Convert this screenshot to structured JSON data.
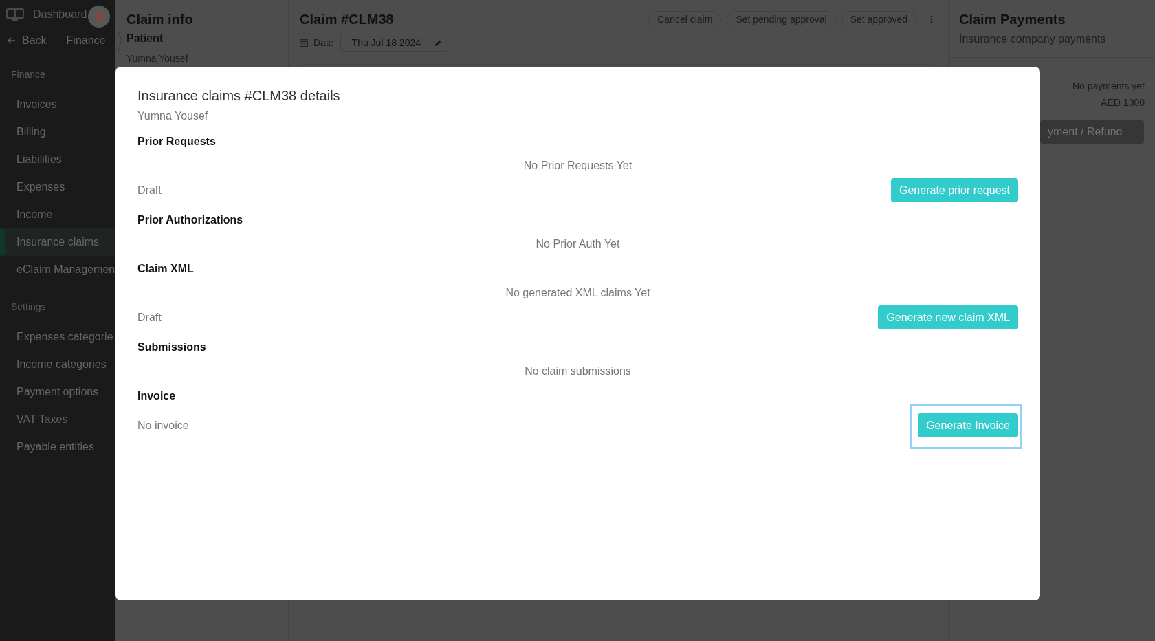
{
  "sidebar": {
    "brand": "Dashboard",
    "back": "Back",
    "breadcrumb": "Finance",
    "sections": [
      {
        "label": "Finance",
        "items": [
          {
            "label": "Invoices",
            "selected": false
          },
          {
            "label": "Billing",
            "selected": false
          },
          {
            "label": "Liabilities",
            "selected": false
          },
          {
            "label": "Expenses",
            "selected": false
          },
          {
            "label": "Income",
            "selected": false
          },
          {
            "label": "Insurance claims",
            "selected": true
          },
          {
            "label": "eClaim Managemen",
            "selected": false
          }
        ]
      },
      {
        "label": "Settings",
        "items": [
          {
            "label": "Expenses categorie",
            "selected": false
          },
          {
            "label": "Income categories",
            "selected": false
          },
          {
            "label": "Payment options",
            "selected": false
          },
          {
            "label": "VAT Taxes",
            "selected": false
          },
          {
            "label": "Payable entities",
            "selected": false
          }
        ]
      }
    ]
  },
  "claim_info": {
    "title": "Claim info",
    "patient_label": "Patient",
    "patient_name": "Yumna Yousef"
  },
  "claim": {
    "title": "Claim #CLM38",
    "actions": [
      "Cancel claim",
      "Set pending approval",
      "Set approved"
    ],
    "date_label": "Date",
    "date_value": "Thu Jul 18 2024"
  },
  "payments": {
    "title": "Claim Payments",
    "subtitle": "Insurance company payments",
    "status": "No payments yet",
    "amount": "AED 1300",
    "button": "yment / Refund"
  },
  "modal": {
    "title": "Insurance claims #CLM38 details",
    "patient": "Yumna Yousef",
    "sections": [
      {
        "heading": "Prior Requests",
        "empty_text": "No Prior Requests Yet",
        "rows": [
          {
            "status": "Draft",
            "action": "Generate prior request",
            "focused": false
          }
        ]
      },
      {
        "heading": "Prior Authorizations",
        "empty_text": "No Prior Auth Yet"
      },
      {
        "heading": "Claim XML",
        "empty_text": "No generated XML claims Yet",
        "rows": [
          {
            "status": "Draft",
            "action": "Generate new claim XML",
            "focused": false
          }
        ]
      },
      {
        "heading": "Submissions",
        "empty_text": "No claim submissions"
      },
      {
        "heading": "Invoice",
        "rows": [
          {
            "status": "No invoice",
            "action": "Generate Invoice",
            "focused": true
          }
        ]
      }
    ]
  }
}
